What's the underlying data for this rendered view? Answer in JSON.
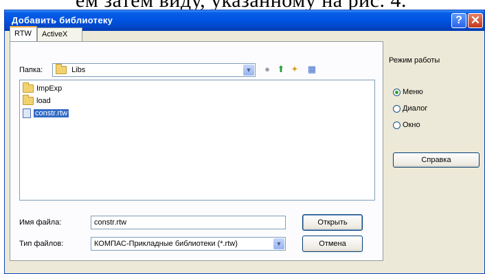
{
  "caption": "ем затем виду, указанному на рис. 4.",
  "window": {
    "title": "Добавить библиотеку",
    "help_glyph": "?",
    "close_glyph": "✕"
  },
  "tabs": [
    {
      "label": "RTW",
      "active": true
    },
    {
      "label": "ActiveX",
      "active": false
    }
  ],
  "folder": {
    "label": "Папка:",
    "value": "Libs",
    "icon": "folder-icon"
  },
  "toolbar": {
    "back_glyph": "●",
    "up_glyph": "⬆",
    "newfolder_glyph": "✦",
    "view_glyph": "▦"
  },
  "files": [
    {
      "name": "ImpExp",
      "icon": "folder-icon"
    },
    {
      "name": "load",
      "icon": "folder-icon"
    },
    {
      "name": "constr.rtw",
      "icon": "file-icon",
      "selected": true
    }
  ],
  "filename": {
    "label": "Имя файла:",
    "value": "constr.rtw"
  },
  "filetype": {
    "label": "Тип файлов:",
    "value": "КОМПАС-Прикладные библиотеки (*.rtw)"
  },
  "buttons": {
    "open": "Открыть",
    "cancel": "Отмена",
    "help": "Справка"
  },
  "mode": {
    "title": "Режим работы",
    "options": [
      {
        "label": "Меню",
        "selected": true
      },
      {
        "label": "Диалог",
        "selected": false
      },
      {
        "label": "Окно",
        "selected": false
      }
    ]
  },
  "colors": {
    "titlebar": "#0054e3",
    "selection": "#316ac5",
    "dialog_bg": "#ece9d8"
  }
}
